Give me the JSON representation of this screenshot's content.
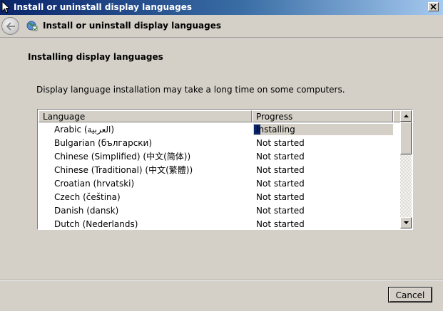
{
  "window": {
    "title": "Install or uninstall display languages"
  },
  "nav": {
    "title": "Install or uninstall display languages",
    "back_icon": "back-arrow-icon",
    "app_icon": "language-globe-icon"
  },
  "main": {
    "heading": "Installing display languages",
    "description": "Display language installation may take a long time on some computers."
  },
  "list": {
    "columns": [
      "Language",
      "Progress"
    ],
    "rows": [
      {
        "language": "Arabic (العربية)",
        "progress": "Installing"
      },
      {
        "language": "Bulgarian (български)",
        "progress": "Not started"
      },
      {
        "language": "Chinese (Simplified) (中文(简体))",
        "progress": "Not started"
      },
      {
        "language": "Chinese (Traditional) (中文(繁體))",
        "progress": "Not started"
      },
      {
        "language": "Croatian (hrvatski)",
        "progress": "Not started"
      },
      {
        "language": "Czech (čeština)",
        "progress": "Not started"
      },
      {
        "language": "Danish (dansk)",
        "progress": "Not started"
      },
      {
        "language": "Dutch (Nederlands)",
        "progress": "Not started"
      }
    ]
  },
  "footer": {
    "cancel_label": "Cancel"
  }
}
